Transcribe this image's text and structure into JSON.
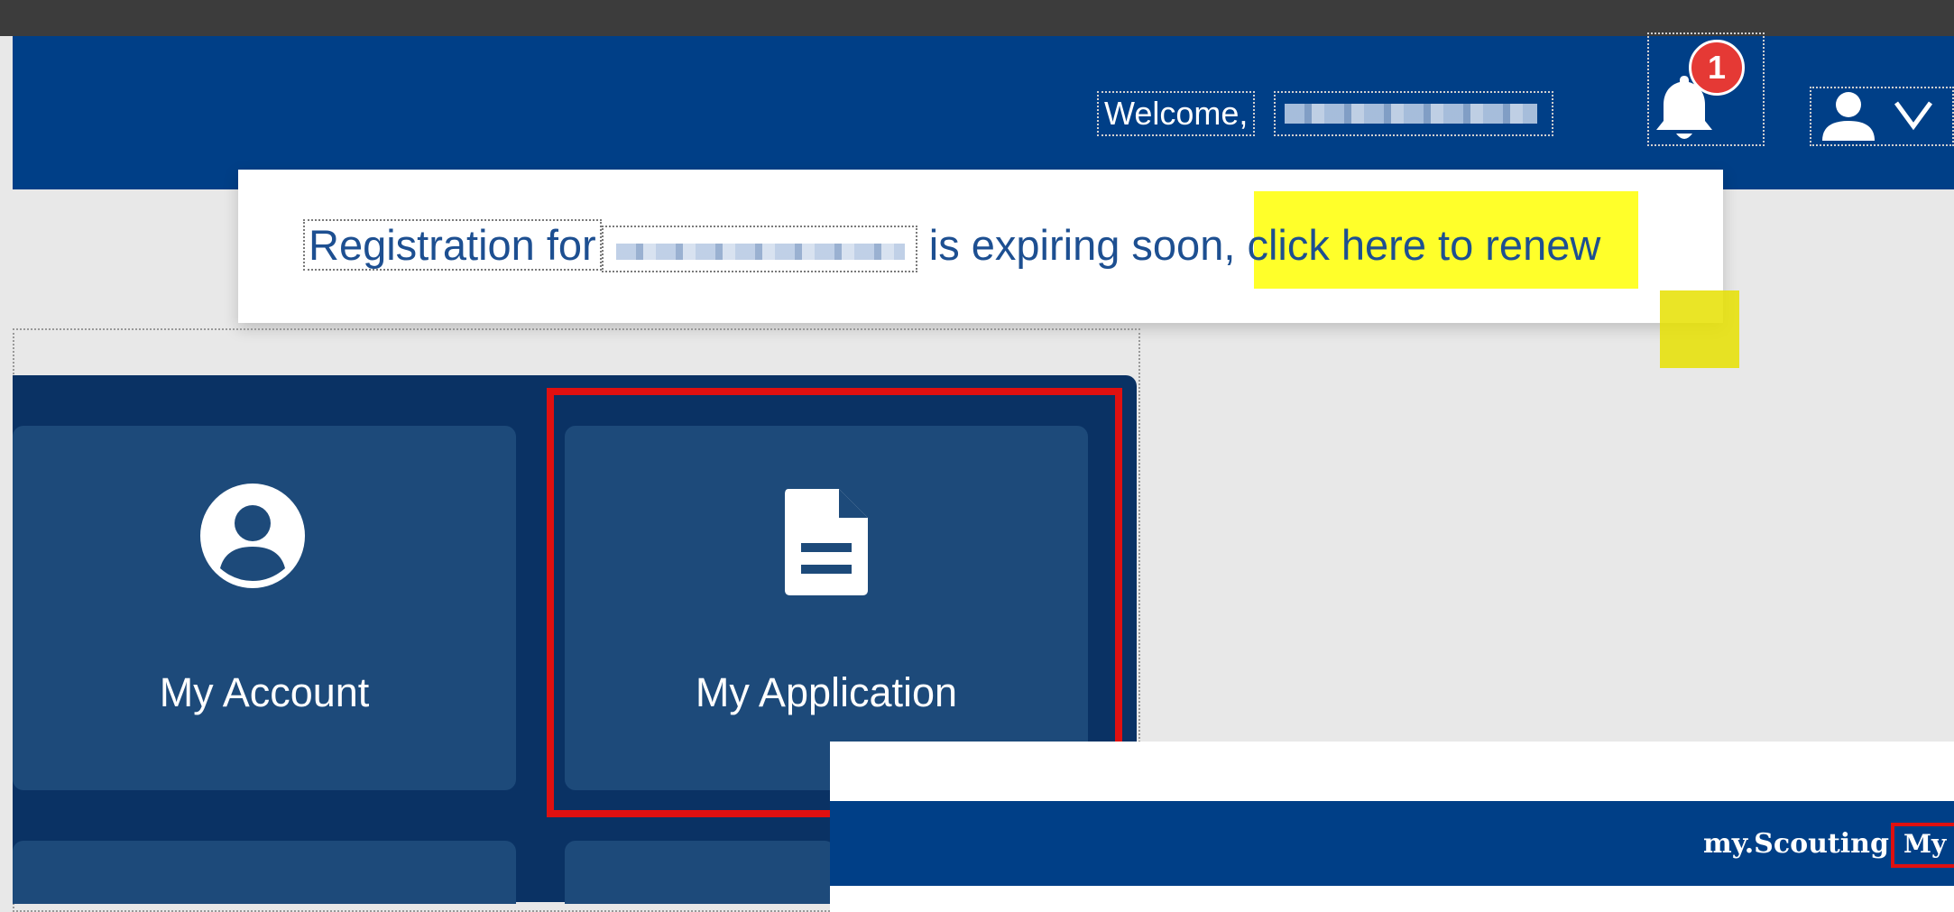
{
  "header": {
    "welcome_label": "Welcome,",
    "notification_count": "1"
  },
  "alert": {
    "prefix": "Registration for",
    "middle": "is expiring soon",
    "link": ", click here to renew"
  },
  "tiles": [
    {
      "label": "My Account",
      "icon": "user-circle-icon"
    },
    {
      "label": "My Application",
      "icon": "document-icon"
    }
  ],
  "popup": {
    "brand": "my.Scouting",
    "menu_link": "My Applications"
  },
  "colors": {
    "header_bg": "#003f87",
    "panel_bg": "#0a3264",
    "tile_bg": "#1d4a7a",
    "highlight": "#ffff2a",
    "annotation_red": "#e01010",
    "badge_red": "#e53935"
  }
}
